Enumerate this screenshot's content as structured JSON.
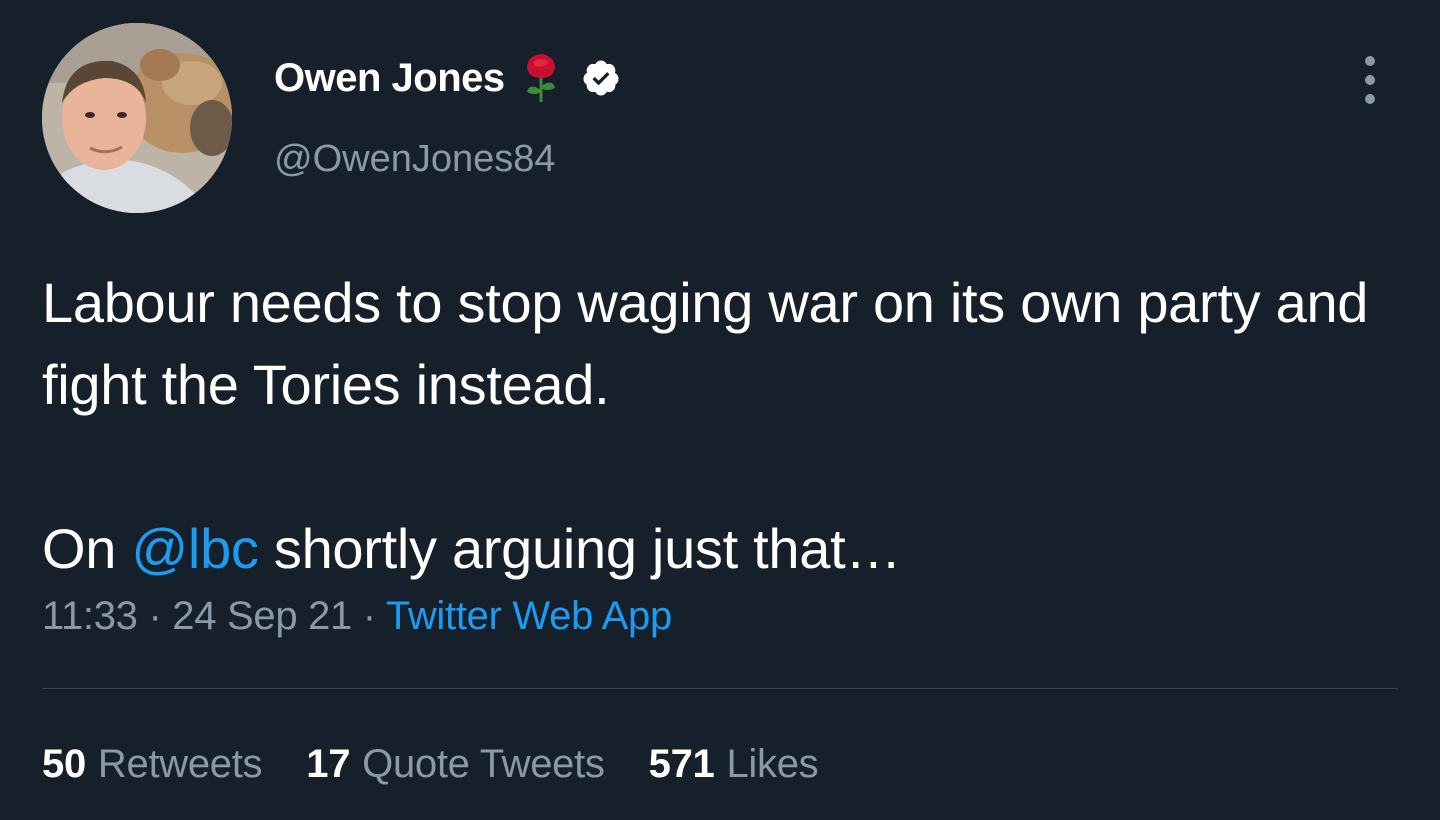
{
  "author": {
    "display_name": "Owen Jones",
    "handle": "@OwenJones84",
    "name_emoji": "rose-icon",
    "verified": true
  },
  "tweet": {
    "line1": "Labour needs to stop waging war on its own party and fight the Tories instead.",
    "line2_prefix": "On ",
    "mention": "@lbc",
    "line2_suffix": " shortly arguing just that…"
  },
  "meta": {
    "time": "11:33",
    "separator1": " · ",
    "date": "24 Sep 21",
    "separator2": " · ",
    "source": "Twitter Web App"
  },
  "stats": {
    "retweets": {
      "count": "50",
      "label": "Retweets"
    },
    "quotes": {
      "count": "17",
      "label": "Quote Tweets"
    },
    "likes": {
      "count": "571",
      "label": "Likes"
    }
  },
  "colors": {
    "background": "#15202b",
    "text": "#ffffff",
    "secondary": "#8b98a5",
    "link": "#1d9bf0",
    "divider": "#38444d"
  }
}
